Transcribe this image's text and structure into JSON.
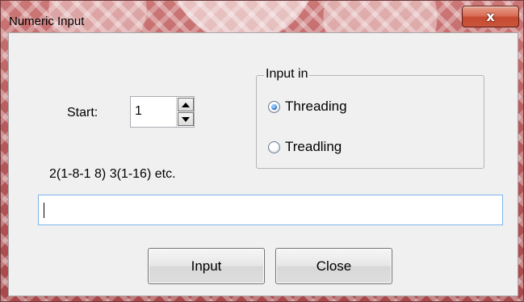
{
  "window": {
    "title": "Numeric Input",
    "close_glyph": "x",
    "accent_color": "#c9553a"
  },
  "start": {
    "label": "Start:",
    "value": "1"
  },
  "input_group": {
    "title": "Input in",
    "options": [
      {
        "label": "Threading",
        "checked": true
      },
      {
        "label": "Treadling",
        "checked": false
      }
    ]
  },
  "hint": {
    "text": "2(1-8-1 8) 3(1-16)  etc."
  },
  "sequence_input": {
    "value": ""
  },
  "buttons": {
    "input_label": "Input",
    "close_label": "Close"
  },
  "icons": [
    "close-icon",
    "spin-up-icon",
    "spin-down-icon",
    "radio-icon"
  ]
}
